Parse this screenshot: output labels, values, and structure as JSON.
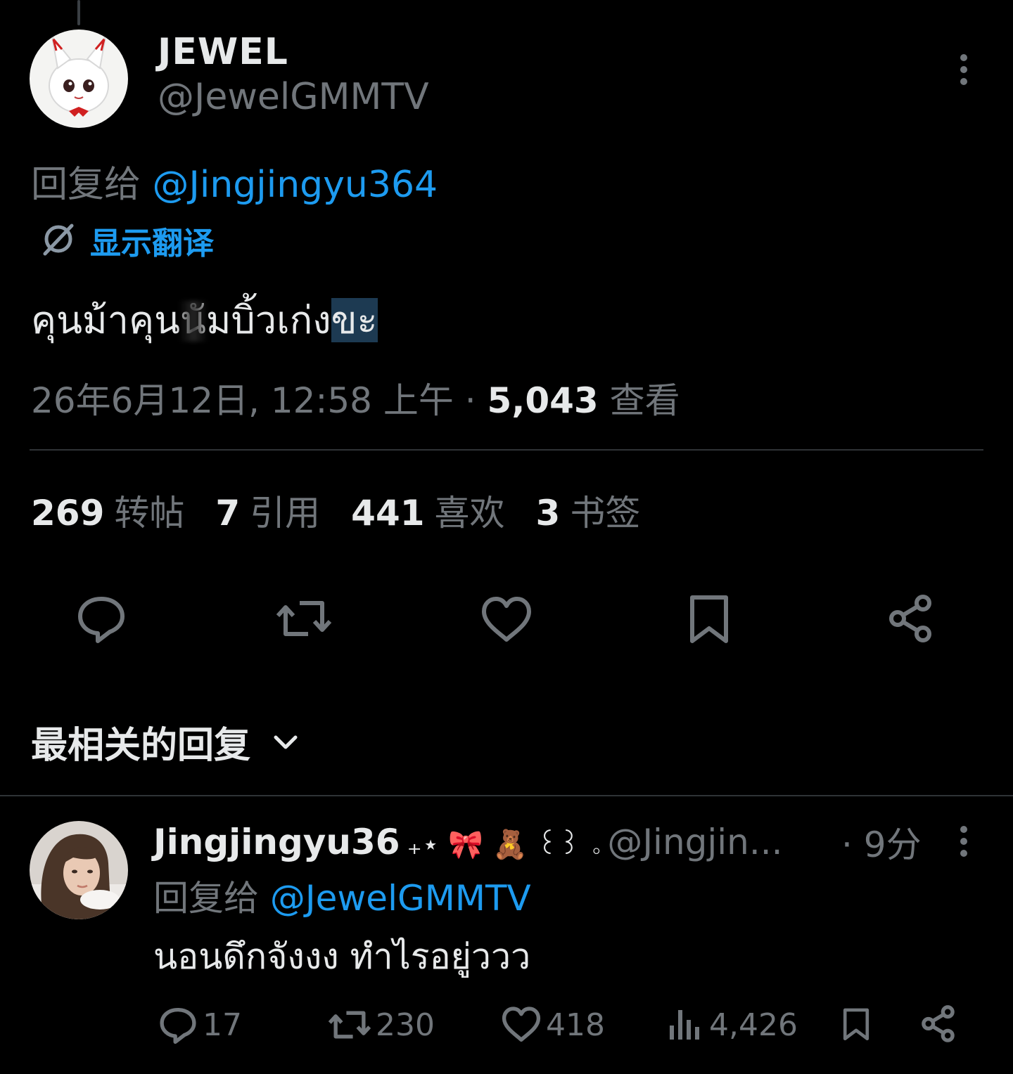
{
  "main_tweet": {
    "display_name": "JEWEL",
    "handle": "@JewelGMMTV",
    "reply_prefix": "回复给",
    "reply_to": "@Jingjingyu364",
    "translate_label": "显示翻译",
    "text_before": "คุนม้าคุน",
    "text_middle": "นัมบิ้วเก่ง",
    "text_highlight": "ขะ",
    "timestamp": "26年6月12日, 12:58 上午",
    "separator": " · ",
    "views_count": "5,043",
    "views_label": "查看",
    "stats": [
      {
        "num": "269",
        "label": "转帖"
      },
      {
        "num": "7",
        "label": "引用"
      },
      {
        "num": "441",
        "label": "喜欢"
      },
      {
        "num": "3",
        "label": "书签"
      }
    ]
  },
  "sort_label": "最相关的回复",
  "reply": {
    "display_name": "Jingjingyu36",
    "name_emoji": "₊⋆ 🎀 🧸 ꒰꒱ ｡",
    "handle": "@Jingjin...",
    "time": "· 9分",
    "reply_prefix": "回复给",
    "reply_to": "@JewelGMMTV",
    "text": "นอนดึกจังงง ทำไรอยู่ววว",
    "replies": "17",
    "reposts": "230",
    "likes": "418",
    "views": "4,426"
  },
  "colors": {
    "background": "#000000",
    "text": "#e7e9ea",
    "muted": "#71767b",
    "accent": "#1d9bf0",
    "divider": "#2f3336"
  },
  "icons": [
    "more-vertical-icon",
    "translate-icon",
    "reply-icon",
    "repost-icon",
    "like-icon",
    "bookmark-icon",
    "share-icon",
    "chevron-down-icon",
    "views-icon"
  ]
}
